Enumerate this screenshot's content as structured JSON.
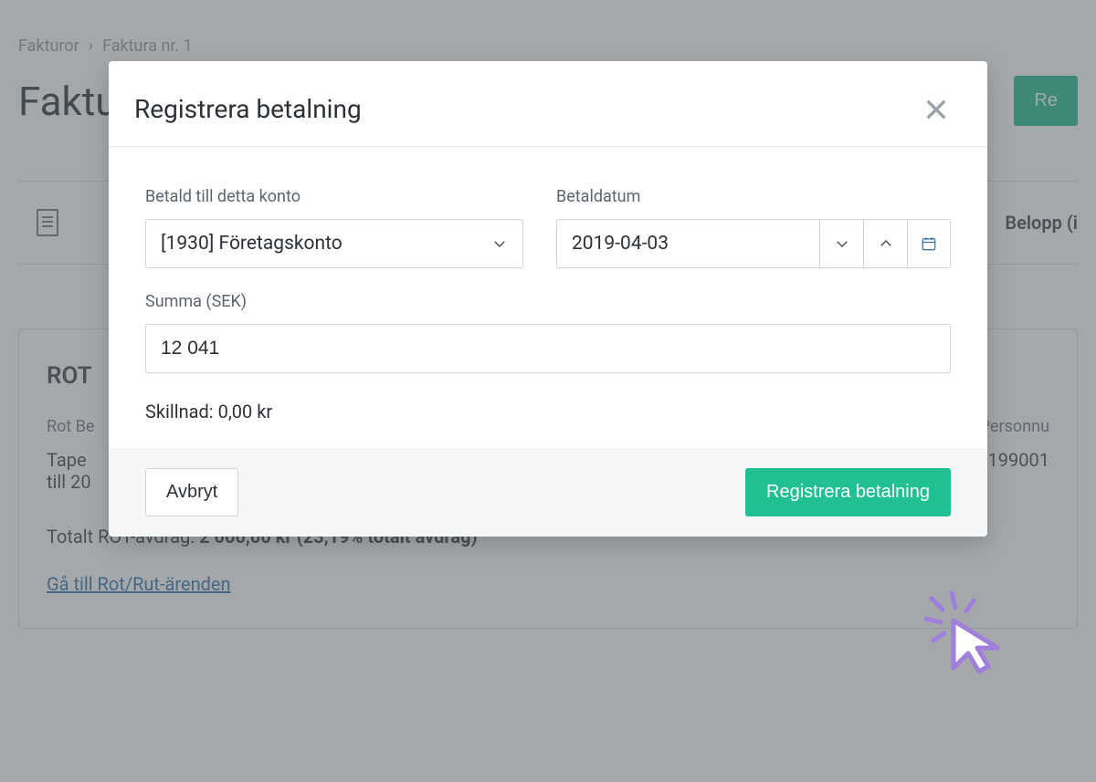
{
  "breadcrumb": {
    "a": "Fakturor",
    "b": "Faktura nr. 1"
  },
  "page": {
    "title": "Faktu",
    "reg_btn": "Re",
    "amount_col": "Belopp (i"
  },
  "card": {
    "title": "ROT",
    "col_a": "Rot Be",
    "col_b": "Personnu",
    "val_a_line1": "Tape",
    "val_a_line2": "till 20",
    "val_b": "199001",
    "total_prefix": "Totalt ROT-avdrag: ",
    "total_bold": "2 000,00 kr (23,19% totalt avdrag)",
    "link": "Gå till Rot/Rut-ärenden"
  },
  "modal": {
    "title": "Registrera betalning",
    "account_label": "Betald till detta konto",
    "account_value": "[1930] Företagskonto",
    "date_label": "Betaldatum",
    "date_value": "2019-04-03",
    "sum_label": "Summa (SEK)",
    "sum_value": "12 041",
    "diff": "Skillnad: 0,00 kr",
    "cancel": "Avbryt",
    "submit": "Registrera betalning"
  }
}
